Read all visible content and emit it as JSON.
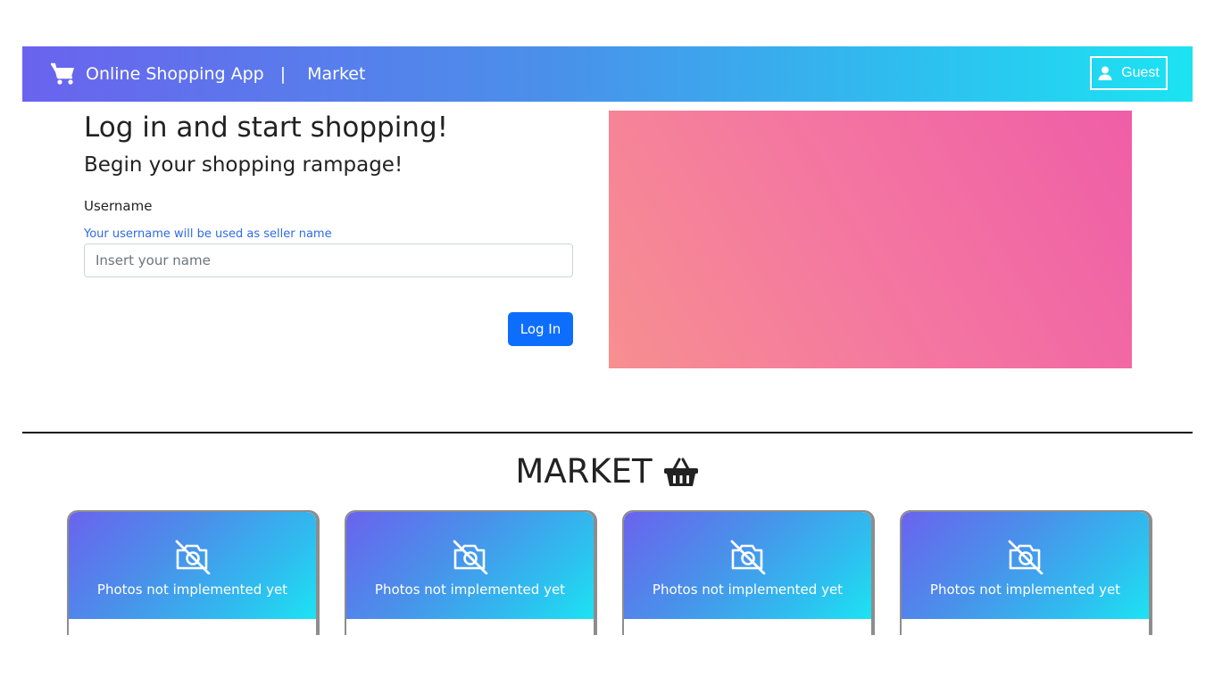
{
  "navbar": {
    "brand": "Online Shopping App",
    "separator": "|",
    "market_link": "Market",
    "guest_label": "Guest",
    "brand_icon": "shopping-cart-icon",
    "user_icon": "user-icon"
  },
  "login": {
    "title": "Log in and start shopping!",
    "subtitle": "Begin your shopping rampage!",
    "username_label": "Username",
    "username_hint": "Your username will be used as seller name",
    "username_placeholder": "Insert your name",
    "username_value": "",
    "button_label": "Log In"
  },
  "market": {
    "title": "MARKET",
    "title_icon": "shopping-basket-icon",
    "cards": [
      {
        "photo_text": "Photos not implemented yet",
        "icon": "camera-off-icon"
      },
      {
        "photo_text": "Photos not implemented yet",
        "icon": "camera-off-icon"
      },
      {
        "photo_text": "Photos not implemented yet",
        "icon": "camera-off-icon"
      },
      {
        "photo_text": "Photos not implemented yet",
        "icon": "camera-off-icon"
      }
    ]
  },
  "colors": {
    "navbar_gradient": [
      "#6a63ee",
      "#1ce3f2"
    ],
    "hero_gradient": [
      "#f78f90",
      "#ef5ea7"
    ],
    "primary_button": "#0d6efd",
    "hint_text": "#2d6be4"
  }
}
